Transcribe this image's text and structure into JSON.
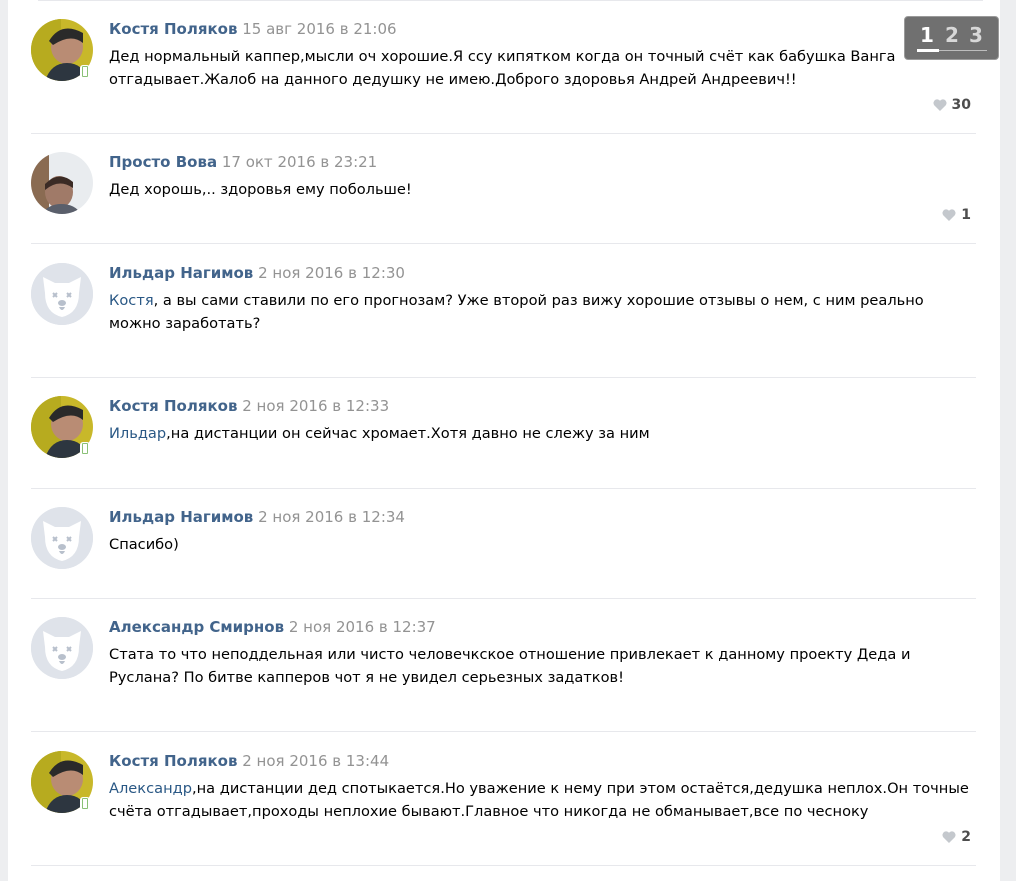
{
  "pagination": {
    "pages": [
      "1",
      "2",
      "3"
    ],
    "current": "1"
  },
  "comments": [
    {
      "author": "Костя Поляков",
      "date": "15 авг 2016 в 21:06",
      "mention": "",
      "text": "Дед нормальный каппер,мысли оч хорошие.Я ссу кипятком когда он точный счёт как бабушка Ванга отгадывает.Жалоб на данного дедушку не имею.Доброго здоровья Андрей Андреевич!!",
      "likes": "30"
    },
    {
      "author": "Просто Вова",
      "date": "17 окт 2016 в 23:21",
      "mention": "",
      "text": "Дед хорошь,.. здоровья ему побольше!",
      "likes": "1"
    },
    {
      "author": "Ильдар Нагимов",
      "date": "2 ноя 2016 в 12:30",
      "mention": "Костя",
      "text": ", а вы сами ставили по его прогнозам? Уже второй раз вижу хорошие отзывы о нем, с ним реально можно заработать?",
      "likes": ""
    },
    {
      "author": "Костя Поляков",
      "date": "2 ноя 2016 в 12:33",
      "mention": "Ильдар",
      "text": ",на дистанции он сейчас хромает.Хотя давно не слежу за ним",
      "likes": ""
    },
    {
      "author": "Ильдар Нагимов",
      "date": "2 ноя 2016 в 12:34",
      "mention": "",
      "text": "Спасибо)",
      "likes": ""
    },
    {
      "author": "Александр Смирнов",
      "date": "2 ноя 2016 в 12:37",
      "mention": "",
      "text": "Стата то что неподдельная или чисто человечкское отношение привлекает к данному проекту Деда и Руслана? По битве капперов чот я не увидел серьезных задатков!",
      "likes": ""
    },
    {
      "author": "Костя Поляков",
      "date": "2 ноя 2016 в 13:44",
      "mention": "Александр",
      "text": ",на дистанции дед спотыкается.Но уважение к нему при этом остаётся,дедушка неплох.Он точные счёта отгадывает,проходы неплохие бывают.Главное что никогда не обманывает,все по чесноку",
      "likes": "2"
    }
  ]
}
